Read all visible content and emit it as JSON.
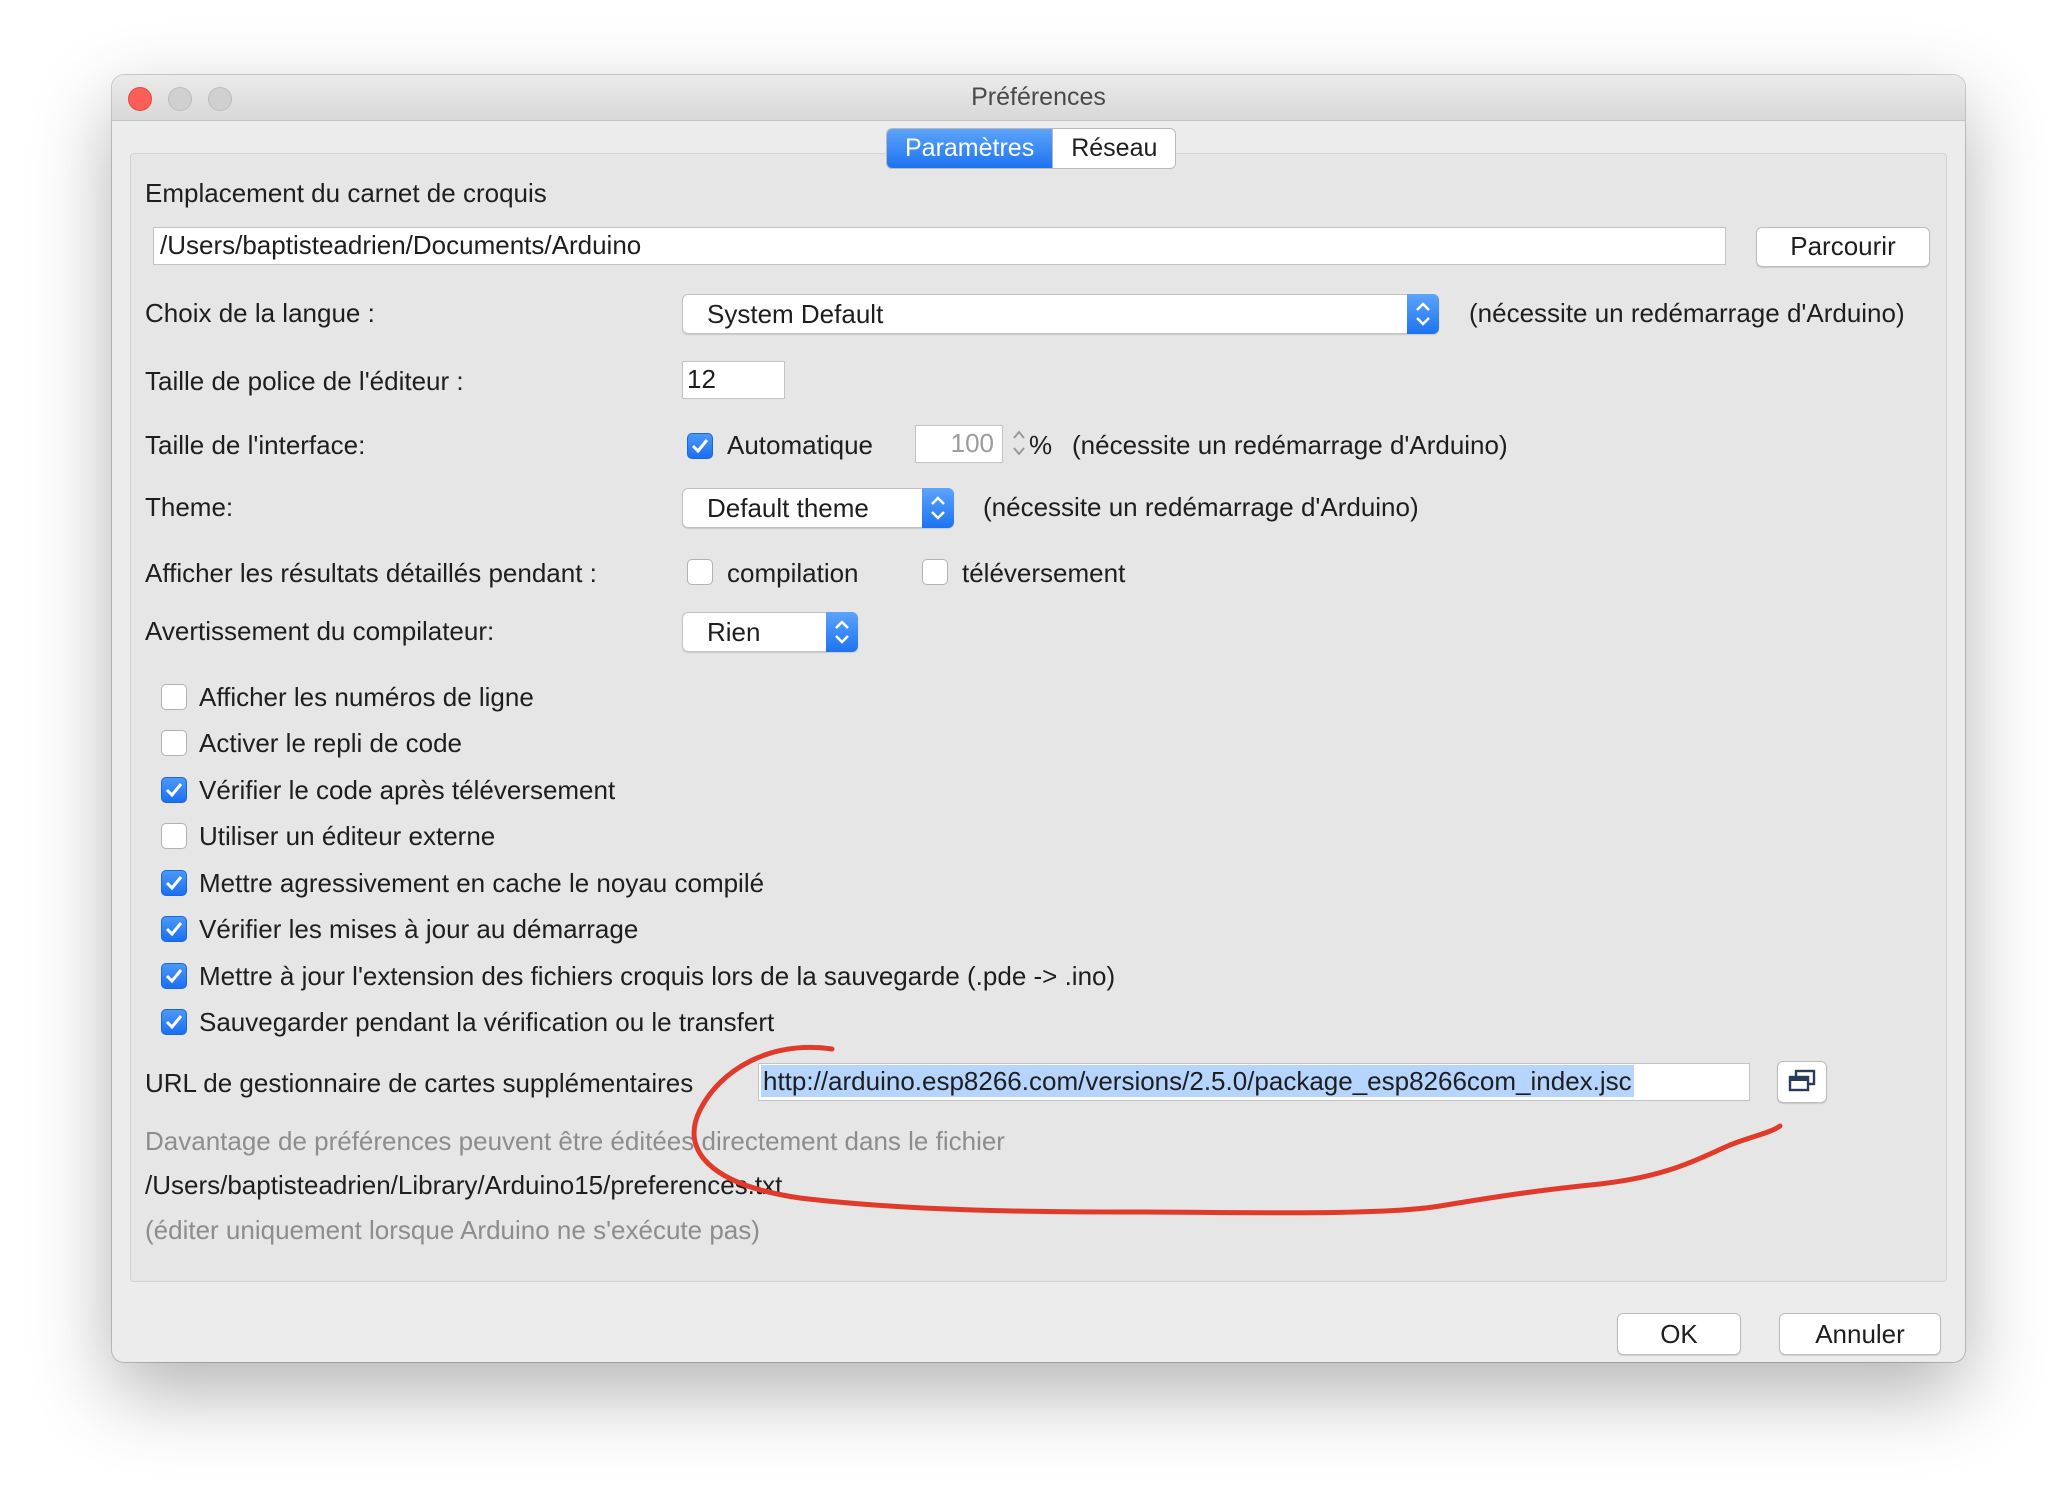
{
  "window": {
    "title": "Préférences",
    "tabs": [
      {
        "label": "Paramètres"
      },
      {
        "label": "Réseau"
      }
    ]
  },
  "sketchbook": {
    "label": "Emplacement du carnet de croquis",
    "path": "/Users/baptisteadrien/Documents/Arduino",
    "browse_label": "Parcourir"
  },
  "language": {
    "label": "Choix de la langue :",
    "value": "System Default",
    "note": "(nécessite un redémarrage d'Arduino)"
  },
  "font_size": {
    "label": "Taille de police de l'éditeur :",
    "value": "12"
  },
  "interface_size": {
    "label": "Taille de l'interface:",
    "auto_label": "Automatique",
    "auto_checked": true,
    "value": "100",
    "percent": "%",
    "note": "(nécessite un redémarrage d'Arduino)"
  },
  "theme": {
    "label": "Theme:",
    "value": "Default theme",
    "note": "(nécessite un redémarrage d'Arduino)"
  },
  "verbose": {
    "label": "Afficher les résultats détaillés pendant :",
    "compile_label": "compilation",
    "compile_checked": false,
    "upload_label": "téléversement",
    "upload_checked": false
  },
  "warnings": {
    "label": "Avertissement du compilateur:",
    "value": "Rien"
  },
  "options": [
    {
      "label": "Afficher les numéros de ligne",
      "checked": false
    },
    {
      "label": "Activer le repli de code",
      "checked": false
    },
    {
      "label": "Vérifier le code après téléversement",
      "checked": true
    },
    {
      "label": "Utiliser un éditeur externe",
      "checked": false
    },
    {
      "label": "Mettre agressivement en cache le noyau compilé",
      "checked": true
    },
    {
      "label": "Vérifier les mises à jour au démarrage",
      "checked": true
    },
    {
      "label": "Mettre à jour  l'extension des fichiers croquis lors de la sauvegarde (.pde -> .ino)",
      "checked": true
    },
    {
      "label": "Sauvegarder pendant la vérification ou le transfert",
      "checked": true
    }
  ],
  "boards_url": {
    "label": "URL de gestionnaire de cartes supplémentaires",
    "value": "http://arduino.esp8266.com/versions/2.5.0/package_esp8266com_index.jsc"
  },
  "footer": {
    "more_info": "Davantage de préférences peuvent être éditées directement dans le fichier",
    "prefs_path": "/Users/baptisteadrien/Library/Arduino15/preferences.txt",
    "edit_note": "(éditer uniquement lorsque Arduino ne s'exécute pas)"
  },
  "buttons": {
    "ok": "OK",
    "cancel": "Annuler"
  },
  "colors": {
    "accent": "#1d73f0",
    "annotation": "#e23a2a",
    "close": "#fc5f57"
  }
}
